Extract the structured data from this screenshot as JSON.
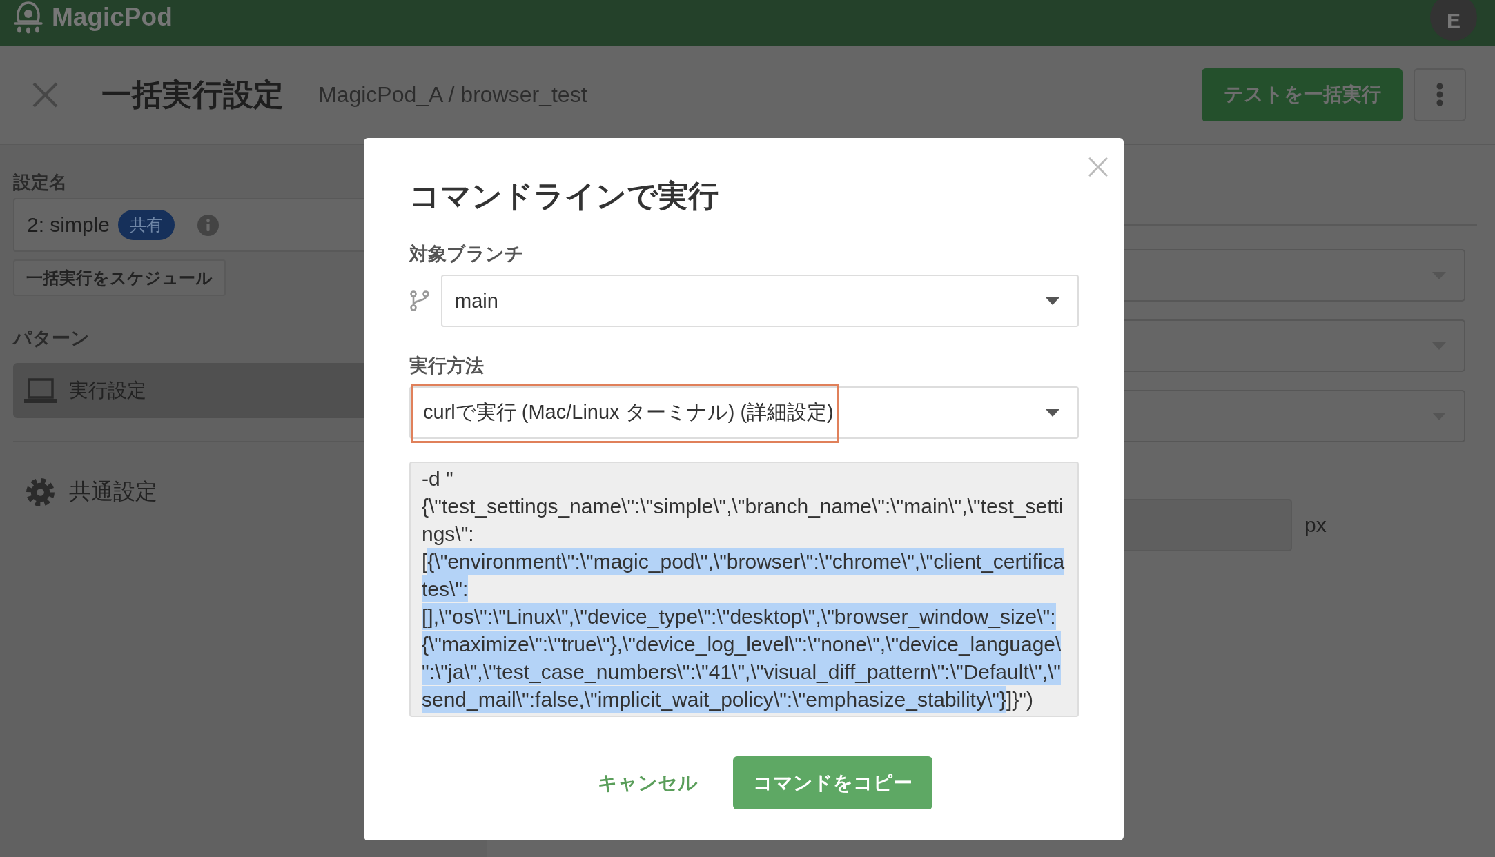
{
  "app_bar": {
    "logo_text": "MagicPod",
    "avatar": "E"
  },
  "header": {
    "title": "一括実行設定",
    "breadcrumb": "MagicPod_A / browser_test",
    "run_button": "テストを一括実行"
  },
  "sidebar": {
    "settings_name_label": "設定名",
    "settings_name": {
      "value": "2: simple",
      "badge": "共有"
    },
    "schedule_button": "一括実行をスケジュール",
    "pattern_label": "パターン",
    "patterns": [
      {
        "label": "実行設定",
        "selected": true
      }
    ],
    "common_settings": "共通設定"
  },
  "main_panel": {
    "fields": [
      {
        "kind": "dropdown"
      },
      {
        "kind": "dropdown"
      },
      {
        "kind": "dropdown"
      },
      {
        "kind": "input",
        "unit": "px"
      }
    ]
  },
  "dialog": {
    "title": "コマンドラインで実行",
    "branch": {
      "label": "対象ブランチ",
      "value": "main"
    },
    "method": {
      "label": "実行方法",
      "value": "curlで実行 (Mac/Linux ターミナル) (詳細設定)",
      "highlighted": true
    },
    "command": [
      {
        "text": "-d \"{\\\"test_settings_name\\\":\\\"simple\\\",\\\"branch_name\\\":\\\"main\\\",\\\"test_settings\\\":[",
        "selected": false
      },
      {
        "text": "{\\\"environment\\\":\\\"magic_pod\\\",\\\"browser\\\":\\\"chrome\\\",\\\"client_certificates\\\":[],\\\"os\\\":\\\"Linux\\\",\\\"device_type\\\":\\\"desktop\\\",\\\"browser_window_size\\\":{\\\"maximize\\\":\\\"true\\\"},\\\"device_log_level\\\":\\\"none\\\",\\\"device_language\\\":\\\"ja\\\",\\\"test_case_numbers\\\":\\\"41\\\",\\\"visual_diff_pattern\\\":\\\"Default\\\",\\\"send_mail\\\":false,\\\"implicit_wait_policy\\\":\\\"emphasize_stability\\\"}",
        "selected": true
      },
      {
        "text": "]}\")",
        "selected": false
      }
    ],
    "buttons": [
      {
        "label": "キャンセル",
        "kind": "text"
      },
      {
        "label": "コマンドをコピー",
        "kind": "primary"
      }
    ]
  }
}
